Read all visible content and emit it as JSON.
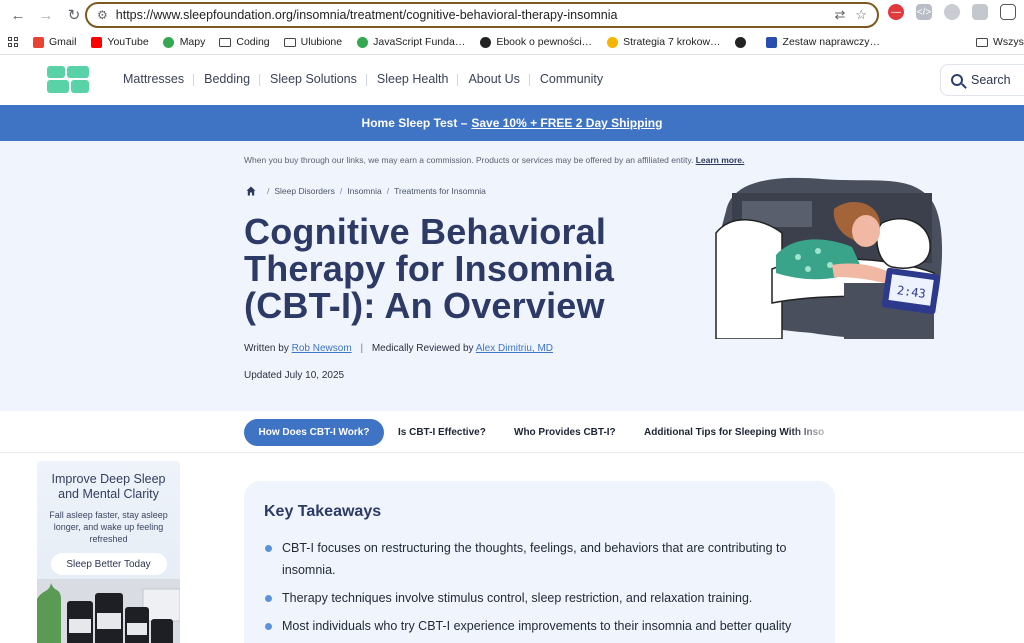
{
  "browser": {
    "url": "https://www.sleepfoundation.org/insomnia/treatment/cognitive-behavioral-therapy-insomnia",
    "bookmarks": [
      {
        "label": "Gmail",
        "icon": "gmail-icon",
        "color": "#ea4335"
      },
      {
        "label": "YouTube",
        "icon": "youtube-icon",
        "color": "#ff0000"
      },
      {
        "label": "Mapy",
        "icon": "maps-icon",
        "color": "#34a853"
      },
      {
        "label": "Coding",
        "icon": "folder-icon",
        "color": "#444444"
      },
      {
        "label": "Ulubione",
        "icon": "folder-icon",
        "color": "#444444"
      },
      {
        "label": "JavaScript Funda…",
        "icon": "globe-icon",
        "color": "#34a853"
      },
      {
        "label": "Ebook o pewności…",
        "icon": "openai-icon",
        "color": "#222222"
      },
      {
        "label": "Strategia 7 krokow…",
        "icon": "coin-icon",
        "color": "#f4b400"
      },
      {
        "label": "",
        "icon": "openai-icon",
        "color": "#222222"
      },
      {
        "label": "Zestaw naprawczy…",
        "icon": "bk-icon",
        "color": "#2a4db0"
      }
    ],
    "bookmarks_right": "Wszystk"
  },
  "site": {
    "nav": [
      "Mattresses",
      "Bedding",
      "Sleep Solutions",
      "Sleep Health",
      "About Us",
      "Community"
    ],
    "search_label": "Search",
    "brand_color": "#5ad2a8",
    "accent_color": "#3f74c4"
  },
  "promo": {
    "prefix": "Home Sleep Test –",
    "link": "Save 10% + FREE 2 Day Shipping"
  },
  "hero": {
    "disclosure": "When you buy through our links, we may earn a commission. Products or services may be offered by an affiliated entity.",
    "disclosure_link": "Learn more.",
    "breadcrumb": [
      "Sleep Disorders",
      "Insomnia",
      "Treatments for Insomnia"
    ],
    "title": "Cognitive Behavioral Therapy for Insomnia (CBT-I): An Overview",
    "written_by_label": "Written by",
    "author": "Rob Newsom",
    "reviewed_label": "Medically Reviewed by",
    "reviewer": "Alex Dimitriu, MD",
    "updated": "Updated July 10, 2025"
  },
  "tabs": {
    "active": "How Does CBT-I Work?",
    "items": [
      "Is CBT-I Effective?",
      "Who Provides CBT-I?",
      "Additional Tips for Sleeping With Inso"
    ]
  },
  "ad": {
    "title": "Improve Deep Sleep and Mental Clarity",
    "subtitle": "Fall asleep faster, stay asleep longer, and wake up feeling refreshed",
    "button": "Sleep Better Today"
  },
  "takeaways": {
    "heading": "Key Takeaways",
    "items": [
      "CBT-I focuses on restructuring the thoughts, feelings, and behaviors that are contributing to insomnia.",
      "Therapy techniques involve stimulus control, sleep restriction, and relaxation training.",
      "Most individuals who try CBT-I experience improvements to their insomnia and better quality"
    ]
  }
}
